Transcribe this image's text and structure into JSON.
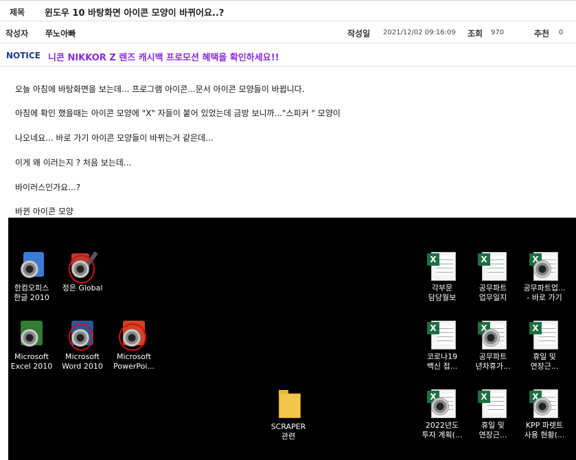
{
  "header": {
    "title_label": "제목",
    "title": "윈도우 10 바탕화면 아이콘 모양이 바뀌어요..?",
    "author_label": "작성자",
    "author": "쭈노아빠",
    "date_label": "작성일",
    "date": "2021/12/02 09:16:09",
    "views_label": "조회",
    "views": "970",
    "recommend_label": "추천",
    "recommend": "0",
    "notice_label": "NOTICE",
    "notice_text": "니콘 NIKKOR Z 렌즈 캐시백 프로모션 혜택을 확인하세요!!"
  },
  "body": {
    "lines": [
      "오늘 아침에 바탕화면을 보는데... 프로그램 아이콘...문서 아이콘 모양들이 바뀝니다.",
      "아침에 확인 했을때는 아이콘 모양에 \"X\" 자들이 붙어 있었는데 금방 보니까...\"스피커 \" 모양이",
      "나오네요... 바로 가기 아이콘 모양들이 바뀌는거 같은데...",
      "이게 왜 이러는지 ? 처음 보는데...",
      "바이러스인가요...?",
      "바뀐 아이콘 모양"
    ]
  },
  "desktop": {
    "icons": [
      {
        "line1": "한컴오피스",
        "line2": "한글 2010"
      },
      {
        "line1": "정은 Global",
        "line2": ""
      },
      {
        "line1": "Microsoft",
        "line2": "Excel 2010"
      },
      {
        "line1": "Microsoft",
        "line2": "Word 2010"
      },
      {
        "line1": "Microsoft",
        "line2": "PowerPoi..."
      },
      {
        "line1": "SCRAPER",
        "line2": "관련"
      },
      {
        "line1": "각부문",
        "line2": "담당월보"
      },
      {
        "line1": "공무파트",
        "line2": "업무일지"
      },
      {
        "line1": "공무파트업...",
        "line2": "- 바로 가기"
      },
      {
        "line1": "코로나19",
        "line2": "백신 접..."
      },
      {
        "line1": "공무파트",
        "line2": "년차휴가..."
      },
      {
        "line1": "휴일 및",
        "line2": "연장근..."
      },
      {
        "line1": "2022년도",
        "line2": "투자 계획(..."
      },
      {
        "line1": "휴일 및",
        "line2": "연장근..."
      },
      {
        "line1": "KPP 파렛트",
        "line2": "사용 현황(..."
      }
    ]
  }
}
